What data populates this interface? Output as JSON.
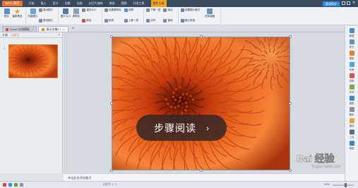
{
  "app": {
    "logo": "WPS 演示",
    "login": "登录同步"
  },
  "menu": [
    {
      "label": "开始",
      "active": false
    },
    {
      "label": "插入",
      "active": false
    },
    {
      "label": "设计",
      "active": false
    },
    {
      "label": "切换",
      "active": false
    },
    {
      "label": "动画",
      "active": false
    },
    {
      "label": "幻灯片放映",
      "active": false
    },
    {
      "label": "审阅",
      "active": false
    },
    {
      "label": "视图",
      "active": false
    },
    {
      "label": "开发工具",
      "active": false
    },
    {
      "label": "图片工具",
      "active": true
    }
  ],
  "ribbon": {
    "big1": "图片",
    "big2": "重新着色",
    "big3": "压缩图片",
    "big4": "图片大小",
    "big5": "清晰化",
    "s1": "重设图片",
    "s2": "更改图片",
    "s3": "重设大小",
    "s4": "颜色",
    "s5": "设置透明色",
    "s6": "轮廓",
    "s7": "效果",
    "s8": "上移一层",
    "s9": "下移一层",
    "s10": "对齐",
    "s11": "组合",
    "s12": "旋转",
    "s13": "设置图片格式",
    "s14": "选择窗格",
    "s15": "图片拼接"
  },
  "tabs": [
    {
      "label": "Docer-在线模板",
      "color": "#d8453a",
      "active": false
    },
    {
      "label": "演示文稿1 *",
      "color": "#e0892a",
      "active": true
    }
  ],
  "left_panel": {
    "tab1": "大纲",
    "tab2": "幻灯片",
    "slide_number": "1"
  },
  "overlay": {
    "text": "步骤阅读",
    "arrow": "›"
  },
  "notes": {
    "text": "单击此处添加备注"
  },
  "right_sidebar": [
    {
      "label": "新建",
      "color": "#4e88c7"
    },
    {
      "label": "样式",
      "color": "#6a8fb7"
    },
    {
      "label": "模板",
      "color": "#e67e2a"
    },
    {
      "label": "动画",
      "color": "#5aa0d8"
    },
    {
      "label": "切换",
      "color": "#d9544d"
    },
    {
      "label": "形状",
      "color": "#7fa84a"
    },
    {
      "label": "图表",
      "color": "#3e8ac2"
    },
    {
      "label": "备份",
      "color": "#8a8fa0"
    },
    {
      "label": "素材",
      "color": "#e2a23b"
    },
    {
      "label": "工具",
      "color": "#5a6e86"
    },
    {
      "label": "帮助",
      "color": "#3b86c9"
    }
  ],
  "status": {
    "slide": "幻灯片 1 / 1",
    "zoom": "50%"
  },
  "watermark": {
    "text": "Bai 经验",
    "sub": "jingyan.baidu.com"
  },
  "colors": {
    "accent": "#e56a17",
    "title_bar": "#3a4a5e",
    "active_menu": "#f3a623"
  }
}
